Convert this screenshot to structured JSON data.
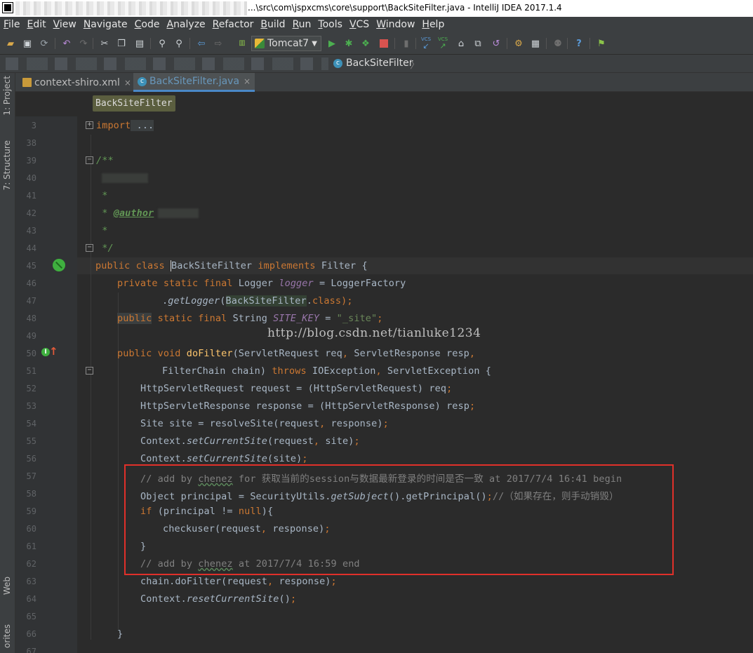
{
  "window": {
    "title": "...\\src\\com\\jspxcms\\core\\support\\BackSiteFilter.java - IntelliJ IDEA 2017.1.4"
  },
  "menu": [
    "File",
    "Edit",
    "View",
    "Navigate",
    "Code",
    "Analyze",
    "Refactor",
    "Build",
    "Run",
    "Tools",
    "VCS",
    "Window",
    "Help"
  ],
  "toolbar": {
    "run_config": "Tomcat7",
    "icons": [
      "open-folder-icon",
      "save-icon",
      "sync-icon",
      "undo-icon",
      "redo-icon",
      "cut-icon",
      "copy-icon",
      "paste-icon",
      "find-icon",
      "replace-icon",
      "back-icon",
      "forward-icon",
      "build-icon",
      "run-icon",
      "debug-icon",
      "coverage-icon",
      "stop-icon",
      "vcs-update-icon",
      "vcs-commit-icon",
      "history-icon",
      "revert-icon",
      "settings-icon",
      "structure-icon",
      "help-icon",
      "plugin-icon"
    ],
    "vcs_labels": [
      "VCS",
      "VCS"
    ]
  },
  "navbar": {
    "current_class": "BackSiteFilter"
  },
  "tool_windows": {
    "project": "1: Project",
    "structure": "7: Structure",
    "web": "Web",
    "favorites": "orites"
  },
  "tabs": [
    {
      "label": "context-shiro.xml",
      "close": "×",
      "active": false
    },
    {
      "label": "BackSiteFilter.java",
      "close": "×",
      "active": true
    }
  ],
  "breadcrumb": "BackSiteFilter",
  "line_numbers": [
    "3",
    "38",
    "39",
    "40",
    "41",
    "42",
    "43",
    "44",
    "45",
    "46",
    "47",
    "48",
    "49",
    "50",
    "51",
    "52",
    "53",
    "54",
    "55",
    "56",
    "57",
    "58",
    "59",
    "60",
    "61",
    "62",
    "63",
    "64",
    "65",
    "66",
    "67"
  ],
  "code": {
    "l3_kw": "import",
    "l3_rest": " ...",
    "l39": "/**",
    "l41": " *",
    "l42_star": " * ",
    "l42_tag": "@author",
    "l43": " *",
    "l44": " */",
    "l45_a": "public class ",
    "l45_b": "BackSiteFilter",
    "l45_c": " implements ",
    "l45_d": "Filter {",
    "l46_a": "private static final ",
    "l46_b": "Logger ",
    "l46_c": "logger",
    "l46_d": " = LoggerFactory",
    "l47_a": ".",
    "l47_b": "getLogger",
    "l47_c": "(",
    "l47_d": "BackSiteFilter",
    "l47_e": ".",
    "l47_f": "class",
    "l47_g": ");",
    "l48_a": "public",
    "l48_b": " static final ",
    "l48_c": "String ",
    "l48_d": "SITE_KEY",
    "l48_e": " = ",
    "l48_f": "\"_site\"",
    "l48_g": ";",
    "l50_a": "public void ",
    "l50_b": "doFilter",
    "l50_c": "(ServletRequest req",
    "l50_d": ", ",
    "l50_e": "ServletResponse resp",
    "l50_f": ",",
    "l51_a": "FilterChain chain) ",
    "l51_b": "throws ",
    "l51_c": "IOException",
    "l51_d": ", ",
    "l51_e": "ServletException {",
    "l52_a": "HttpServletRequest request = (HttpServletRequest) req",
    "l52_b": ";",
    "l53_a": "HttpServletResponse response = (HttpServletResponse) resp",
    "l53_b": ";",
    "l54_a": "Site site = resolveSite(request",
    "l54_b": ", ",
    "l54_c": "response)",
    "l54_d": ";",
    "l55_a": "Context.",
    "l55_b": "setCurrentSite",
    "l55_c": "(request",
    "l55_d": ", ",
    "l55_e": "site)",
    "l55_f": ";",
    "l56_a": "Context.",
    "l56_b": "setCurrentSite",
    "l56_c": "(site)",
    "l56_d": ";",
    "l57_a": "// add by ",
    "l57_b": "chenez",
    "l57_c": " for 获取当前的session与数据最新登录的时间是否一致 at 2017/7/4 16:41 begin",
    "l58_a": "Object principal = SecurityUtils.",
    "l58_b": "getSubject",
    "l58_c": "().getPrincipal()",
    "l58_d": ";",
    "l58_e": "//（如果存在，则手动销毁）",
    "l59_a": "if ",
    "l59_b": "(principal != ",
    "l59_c": "null",
    "l59_d": "){",
    "l60_a": "checkuser(request",
    "l60_b": ", ",
    "l60_c": "response)",
    "l60_d": ";",
    "l61": "}",
    "l62_a": "// add by ",
    "l62_b": "chenez",
    "l62_c": " at 2017/7/4 16:59 end",
    "l63_a": "chain.doFilter(request",
    "l63_b": ", ",
    "l63_c": "response)",
    "l63_d": ";",
    "l64_a": "Context.",
    "l64_b": "resetCurrentSite",
    "l64_c": "()",
    "l64_d": ";",
    "l66": "}"
  },
  "watermark": "http://blog.csdn.net/tianluke1234",
  "colors": {
    "keyword": "#cc7832",
    "comment": "#808080",
    "doc_comment": "#629755",
    "string": "#6a8759",
    "field": "#9876aa",
    "highlight_box": "#e0302a"
  }
}
